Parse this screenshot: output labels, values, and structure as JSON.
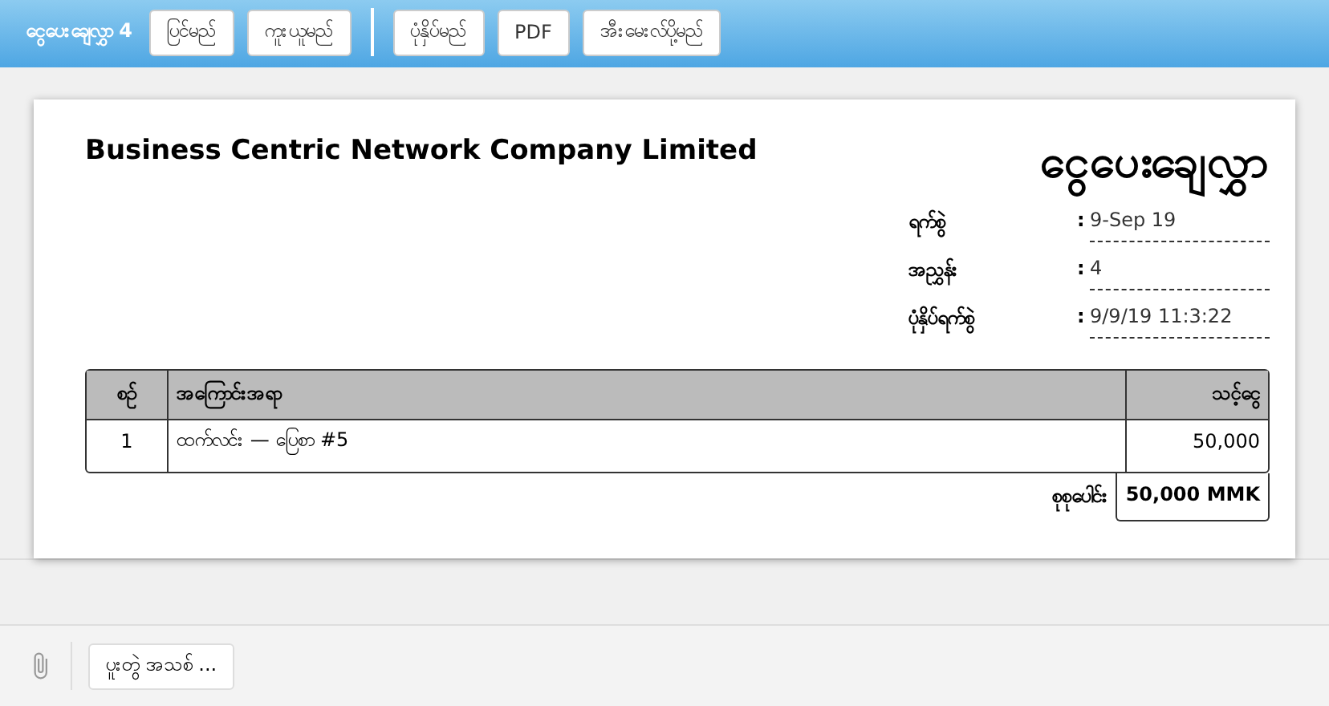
{
  "toolbar": {
    "title": "ငွေပေးချေလွှာ 4",
    "button_groups": [
      [
        "ပြင်မည်",
        "ကူးယူမည်"
      ],
      [
        "ပုံနှိပ်မည်",
        "PDF",
        "အီးမေးလ်ပို့မည်"
      ]
    ]
  },
  "document": {
    "company": "Business Centric Network Company Limited",
    "heading": "ငွေပေးချေလွှာ",
    "meta": [
      {
        "label": "ရက်စွဲ",
        "separator": ":",
        "value": "9-Sep 19"
      },
      {
        "label": "အညွှန်း",
        "separator": ":",
        "value": "4"
      },
      {
        "label": "ပုံနှိပ်ရက်စွဲ",
        "separator": ":",
        "value": "9/9/19 11:3:22"
      }
    ],
    "table": {
      "columns": [
        "စဉ်",
        "အကြောင်းအရာ",
        "သင့်ငွေ"
      ],
      "rows": [
        [
          "1",
          "ထက်လင်း — ပြေစာ #5",
          "50,000"
        ]
      ],
      "total_label": "စုစုပေါင်း",
      "total": "50,000 MMK"
    }
  },
  "footer": {
    "button": "ပူးတွဲ အသစ် ..."
  }
}
